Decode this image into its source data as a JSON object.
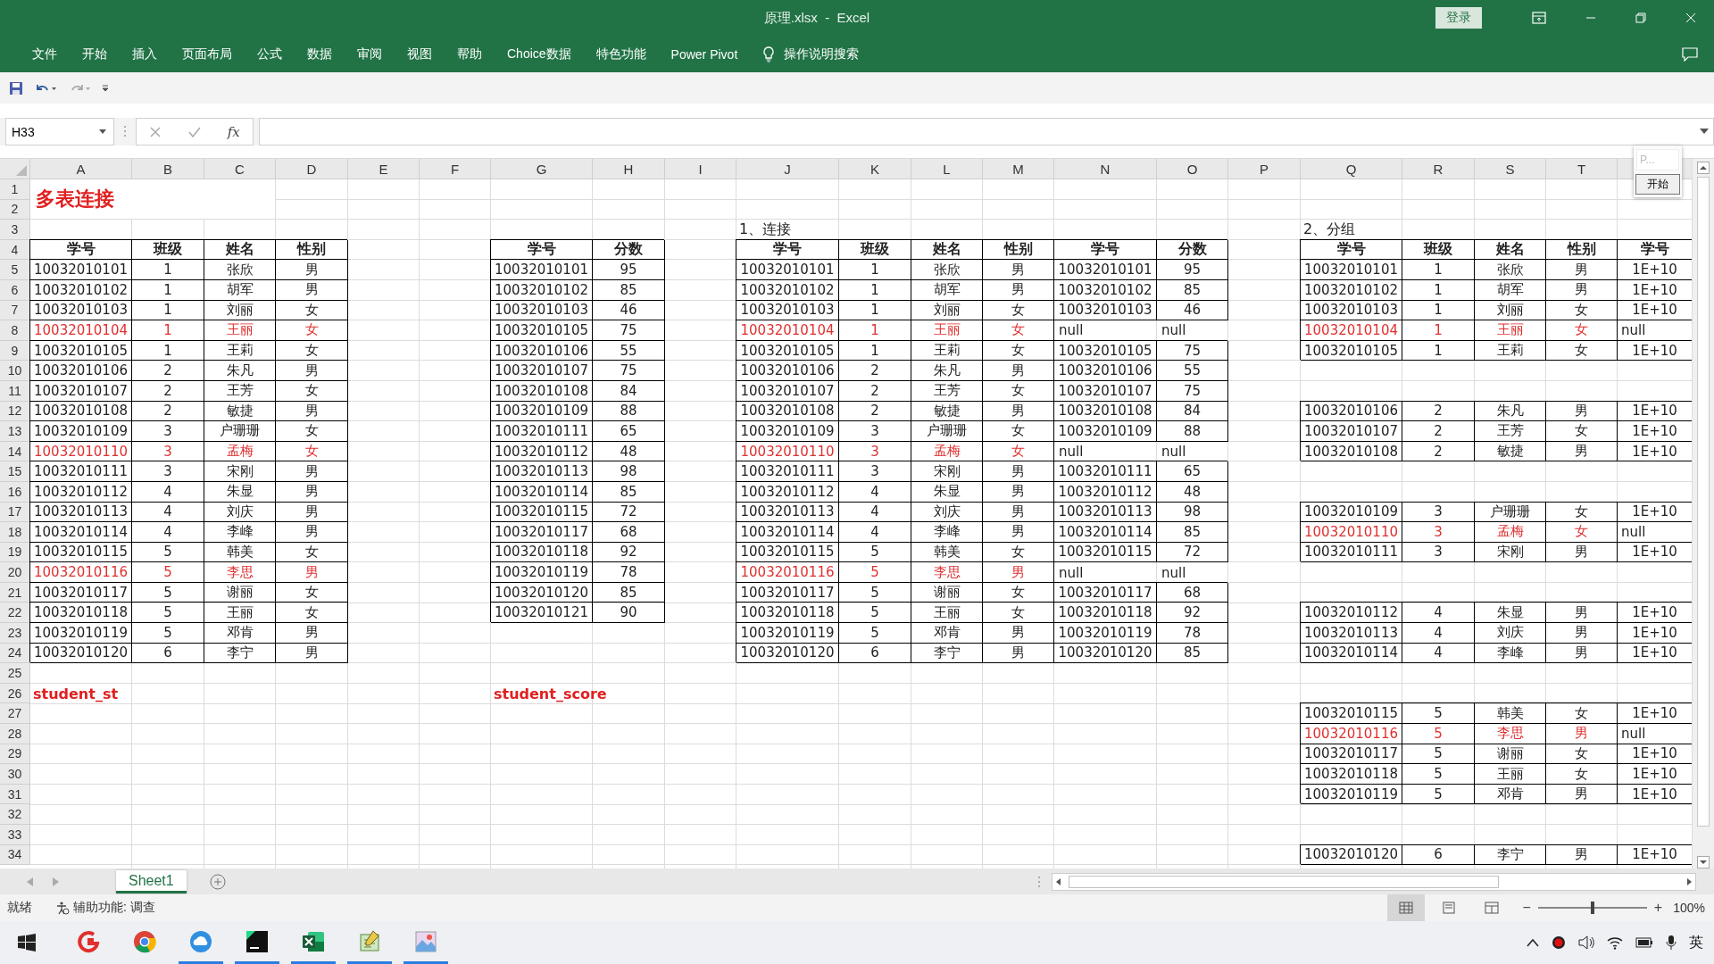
{
  "window": {
    "title": "原理.xlsx  -  Excel",
    "login": "登录"
  },
  "menu_tabs": [
    "文件",
    "开始",
    "插入",
    "页面布局",
    "公式",
    "数据",
    "审阅",
    "视图",
    "帮助",
    "Choice数据",
    "特色功能",
    "Power Pivot"
  ],
  "tell_me": "操作说明搜索",
  "formula_bar": {
    "name_box": "H33",
    "fx": "fx"
  },
  "widget": {
    "label": "P...",
    "button": "开始"
  },
  "sheet": {
    "columns": [
      "A",
      "B",
      "C",
      "D",
      "E",
      "F",
      "G",
      "H",
      "I",
      "J",
      "K",
      "L",
      "M",
      "N",
      "O",
      "P",
      "Q",
      "R",
      "S",
      "T"
    ],
    "row_numbers": [
      "1",
      "2",
      "3",
      "4",
      "5",
      "6",
      "7",
      "8",
      "9",
      "10",
      "11",
      "12",
      "13",
      "14",
      "15",
      "16",
      "17",
      "18",
      "19",
      "20",
      "21",
      "22",
      "23",
      "24",
      "25",
      "26",
      "27",
      "28",
      "29",
      "30",
      "31",
      "32",
      "33",
      "34"
    ],
    "title": "多表连接",
    "student_table": {
      "name": "student_st",
      "columns": [
        "学号",
        "班级",
        "姓名",
        "性别"
      ],
      "rows": [
        {
          "id": "10032010101",
          "class": "1",
          "name": "张欣",
          "gender": "男",
          "unmatched": false
        },
        {
          "id": "10032010102",
          "class": "1",
          "name": "胡军",
          "gender": "男",
          "unmatched": false
        },
        {
          "id": "10032010103",
          "class": "1",
          "name": "刘丽",
          "gender": "女",
          "unmatched": false
        },
        {
          "id": "10032010104",
          "class": "1",
          "name": "王丽",
          "gender": "女",
          "unmatched": true
        },
        {
          "id": "10032010105",
          "class": "1",
          "name": "王莉",
          "gender": "女",
          "unmatched": false
        },
        {
          "id": "10032010106",
          "class": "2",
          "name": "朱凡",
          "gender": "男",
          "unmatched": false
        },
        {
          "id": "10032010107",
          "class": "2",
          "name": "王芳",
          "gender": "女",
          "unmatched": false
        },
        {
          "id": "10032010108",
          "class": "2",
          "name": "敏捷",
          "gender": "男",
          "unmatched": false
        },
        {
          "id": "10032010109",
          "class": "3",
          "name": "户珊珊",
          "gender": "女",
          "unmatched": false
        },
        {
          "id": "10032010110",
          "class": "3",
          "name": "孟梅",
          "gender": "女",
          "unmatched": true
        },
        {
          "id": "10032010111",
          "class": "3",
          "name": "宋刚",
          "gender": "男",
          "unmatched": false
        },
        {
          "id": "10032010112",
          "class": "4",
          "name": "朱显",
          "gender": "男",
          "unmatched": false
        },
        {
          "id": "10032010113",
          "class": "4",
          "name": "刘庆",
          "gender": "男",
          "unmatched": false
        },
        {
          "id": "10032010114",
          "class": "4",
          "name": "李峰",
          "gender": "男",
          "unmatched": false
        },
        {
          "id": "10032010115",
          "class": "5",
          "name": "韩美",
          "gender": "女",
          "unmatched": false
        },
        {
          "id": "10032010116",
          "class": "5",
          "name": "李思",
          "gender": "男",
          "unmatched": true
        },
        {
          "id": "10032010117",
          "class": "5",
          "name": "谢丽",
          "gender": "女",
          "unmatched": false
        },
        {
          "id": "10032010118",
          "class": "5",
          "name": "王丽",
          "gender": "女",
          "unmatched": false
        },
        {
          "id": "10032010119",
          "class": "5",
          "name": "邓肯",
          "gender": "男",
          "unmatched": false
        },
        {
          "id": "10032010120",
          "class": "6",
          "name": "李宁",
          "gender": "男",
          "unmatched": false
        }
      ]
    },
    "score_table": {
      "name": "student_score",
      "columns": [
        "学号",
        "分数"
      ],
      "rows": [
        {
          "id": "10032010101",
          "score": "95"
        },
        {
          "id": "10032010102",
          "score": "85"
        },
        {
          "id": "10032010103",
          "score": "46"
        },
        {
          "id": "10032010105",
          "score": "75"
        },
        {
          "id": "10032010106",
          "score": "55"
        },
        {
          "id": "10032010107",
          "score": "75"
        },
        {
          "id": "10032010108",
          "score": "84"
        },
        {
          "id": "10032010109",
          "score": "88"
        },
        {
          "id": "10032010111",
          "score": "65"
        },
        {
          "id": "10032010112",
          "score": "48"
        },
        {
          "id": "10032010113",
          "score": "98"
        },
        {
          "id": "10032010114",
          "score": "85"
        },
        {
          "id": "10032010115",
          "score": "72"
        },
        {
          "id": "10032010117",
          "score": "68"
        },
        {
          "id": "10032010118",
          "score": "92"
        },
        {
          "id": "10032010119",
          "score": "78"
        },
        {
          "id": "10032010120",
          "score": "85"
        },
        {
          "id": "10032010121",
          "score": "90"
        }
      ]
    },
    "join_table": {
      "caption": "1、连接",
      "columns": [
        "学号",
        "班级",
        "姓名",
        "性别",
        "学号",
        "分数"
      ],
      "rows": [
        {
          "id": "10032010101",
          "class": "1",
          "name": "张欣",
          "gender": "男",
          "score_id": "10032010101",
          "score": "95",
          "unmatched": false
        },
        {
          "id": "10032010102",
          "class": "1",
          "name": "胡军",
          "gender": "男",
          "score_id": "10032010102",
          "score": "85",
          "unmatched": false
        },
        {
          "id": "10032010103",
          "class": "1",
          "name": "刘丽",
          "gender": "女",
          "score_id": "10032010103",
          "score": "46",
          "unmatched": false
        },
        {
          "id": "10032010104",
          "class": "1",
          "name": "王丽",
          "gender": "女",
          "score_id": "null",
          "score": "null",
          "unmatched": true
        },
        {
          "id": "10032010105",
          "class": "1",
          "name": "王莉",
          "gender": "女",
          "score_id": "10032010105",
          "score": "75",
          "unmatched": false
        },
        {
          "id": "10032010106",
          "class": "2",
          "name": "朱凡",
          "gender": "男",
          "score_id": "10032010106",
          "score": "55",
          "unmatched": false
        },
        {
          "id": "10032010107",
          "class": "2",
          "name": "王芳",
          "gender": "女",
          "score_id": "10032010107",
          "score": "75",
          "unmatched": false
        },
        {
          "id": "10032010108",
          "class": "2",
          "name": "敏捷",
          "gender": "男",
          "score_id": "10032010108",
          "score": "84",
          "unmatched": false
        },
        {
          "id": "10032010109",
          "class": "3",
          "name": "户珊珊",
          "gender": "女",
          "score_id": "10032010109",
          "score": "88",
          "unmatched": false
        },
        {
          "id": "10032010110",
          "class": "3",
          "name": "孟梅",
          "gender": "女",
          "score_id": "null",
          "score": "null",
          "unmatched": true
        },
        {
          "id": "10032010111",
          "class": "3",
          "name": "宋刚",
          "gender": "男",
          "score_id": "10032010111",
          "score": "65",
          "unmatched": false
        },
        {
          "id": "10032010112",
          "class": "4",
          "name": "朱显",
          "gender": "男",
          "score_id": "10032010112",
          "score": "48",
          "unmatched": false
        },
        {
          "id": "10032010113",
          "class": "4",
          "name": "刘庆",
          "gender": "男",
          "score_id": "10032010113",
          "score": "98",
          "unmatched": false
        },
        {
          "id": "10032010114",
          "class": "4",
          "name": "李峰",
          "gender": "男",
          "score_id": "10032010114",
          "score": "85",
          "unmatched": false
        },
        {
          "id": "10032010115",
          "class": "5",
          "name": "韩美",
          "gender": "女",
          "score_id": "10032010115",
          "score": "72",
          "unmatched": false
        },
        {
          "id": "10032010116",
          "class": "5",
          "name": "李思",
          "gender": "男",
          "score_id": "null",
          "score": "null",
          "unmatched": true
        },
        {
          "id": "10032010117",
          "class": "5",
          "name": "谢丽",
          "gender": "女",
          "score_id": "10032010117",
          "score": "68",
          "unmatched": false
        },
        {
          "id": "10032010118",
          "class": "5",
          "name": "王丽",
          "gender": "女",
          "score_id": "10032010118",
          "score": "92",
          "unmatched": false
        },
        {
          "id": "10032010119",
          "class": "5",
          "name": "邓肯",
          "gender": "男",
          "score_id": "10032010119",
          "score": "78",
          "unmatched": false
        },
        {
          "id": "10032010120",
          "class": "6",
          "name": "李宁",
          "gender": "男",
          "score_id": "10032010120",
          "score": "85",
          "unmatched": false
        }
      ]
    },
    "group_table": {
      "caption": "2、分组",
      "columns": [
        "学号",
        "班级",
        "姓名",
        "性别",
        "学号"
      ],
      "groups": [
        {
          "rows": [
            {
              "id": "10032010101",
              "class": "1",
              "name": "张欣",
              "gender": "男",
              "id_2": "1E+10",
              "unmatched": false
            },
            {
              "id": "10032010102",
              "class": "1",
              "name": "胡军",
              "gender": "男",
              "id_2": "1E+10",
              "unmatched": false
            },
            {
              "id": "10032010103",
              "class": "1",
              "name": "刘丽",
              "gender": "女",
              "id_2": "1E+10",
              "unmatched": false
            },
            {
              "id": "10032010104",
              "class": "1",
              "name": "王丽",
              "gender": "女",
              "id_2": "null",
              "unmatched": true
            },
            {
              "id": "10032010105",
              "class": "1",
              "name": "王莉",
              "gender": "女",
              "id_2": "1E+10",
              "unmatched": false
            }
          ]
        },
        {
          "rows": [
            {
              "id": "10032010106",
              "class": "2",
              "name": "朱凡",
              "gender": "男",
              "id_2": "1E+10",
              "unmatched": false
            },
            {
              "id": "10032010107",
              "class": "2",
              "name": "王芳",
              "gender": "女",
              "id_2": "1E+10",
              "unmatched": false
            },
            {
              "id": "10032010108",
              "class": "2",
              "name": "敏捷",
              "gender": "男",
              "id_2": "1E+10",
              "unmatched": false
            }
          ]
        },
        {
          "rows": [
            {
              "id": "10032010109",
              "class": "3",
              "name": "户珊珊",
              "gender": "女",
              "id_2": "1E+10",
              "unmatched": false
            },
            {
              "id": "10032010110",
              "class": "3",
              "name": "孟梅",
              "gender": "女",
              "id_2": "null",
              "unmatched": true
            },
            {
              "id": "10032010111",
              "class": "3",
              "name": "宋刚",
              "gender": "男",
              "id_2": "1E+10",
              "unmatched": false
            }
          ]
        },
        {
          "rows": [
            {
              "id": "10032010112",
              "class": "4",
              "name": "朱显",
              "gender": "男",
              "id_2": "1E+10",
              "unmatched": false
            },
            {
              "id": "10032010113",
              "class": "4",
              "name": "刘庆",
              "gender": "男",
              "id_2": "1E+10",
              "unmatched": false
            },
            {
              "id": "10032010114",
              "class": "4",
              "name": "李峰",
              "gender": "男",
              "id_2": "1E+10",
              "unmatched": false
            }
          ]
        },
        {
          "rows": [
            {
              "id": "10032010115",
              "class": "5",
              "name": "韩美",
              "gender": "女",
              "id_2": "1E+10",
              "unmatched": false
            },
            {
              "id": "10032010116",
              "class": "5",
              "name": "李思",
              "gender": "男",
              "id_2": "null",
              "unmatched": true
            },
            {
              "id": "10032010117",
              "class": "5",
              "name": "谢丽",
              "gender": "女",
              "id_2": "1E+10",
              "unmatched": false
            },
            {
              "id": "10032010118",
              "class": "5",
              "name": "王丽",
              "gender": "女",
              "id_2": "1E+10",
              "unmatched": false
            },
            {
              "id": "10032010119",
              "class": "5",
              "name": "邓肯",
              "gender": "男",
              "id_2": "1E+10",
              "unmatched": false
            }
          ]
        },
        {
          "rows": [
            {
              "id": "10032010120",
              "class": "6",
              "name": "李宁",
              "gender": "男",
              "id_2": "1E+10",
              "unmatched": false
            }
          ]
        }
      ]
    }
  },
  "sheet_tabs": [
    {
      "label": "Sheet1",
      "selected": true
    }
  ],
  "status_bar": {
    "text": "就绪",
    "accessibility": "辅助功能: 调查",
    "views": [
      {
        "kind": "normal",
        "selected": true
      },
      {
        "kind": "page_layout",
        "selected": false
      },
      {
        "kind": "page_break",
        "selected": false
      }
    ],
    "zoom": {
      "minus": "−",
      "plus": "+",
      "level": 0.5,
      "reading": "100%"
    }
  },
  "taskbar": {
    "apps": [
      {
        "kind": "g",
        "running": false
      },
      {
        "kind": "chrome",
        "running": false
      },
      {
        "kind": "cloud",
        "running": true
      },
      {
        "kind": "ide",
        "running": true
      },
      {
        "kind": "excel",
        "running": true
      },
      {
        "kind": "notepad",
        "running": true
      },
      {
        "kind": "paint",
        "running": true
      }
    ],
    "ime": "英"
  }
}
